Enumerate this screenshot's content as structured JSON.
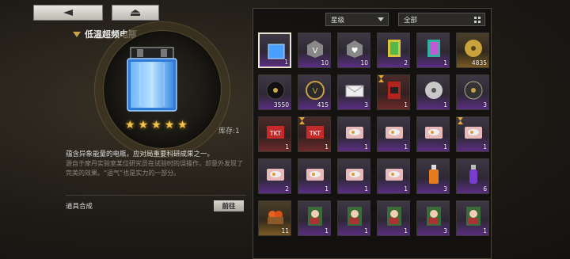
{
  "nav": {
    "back_icon": "back-arrow-icon",
    "home_icon": "home-icon"
  },
  "item": {
    "name": "低温超频电瓶",
    "stars": 5,
    "stock_label": "库存:1",
    "description": "蕴含异象能量的电瓶，应对局重要科研成果之一。",
    "flavor": "源自于摩丹实验室某位研究员在试验时的误操作，却意外发现了完美的效果。“运气”也是实力的一部分。",
    "synth_label": "道具合成",
    "goto_label": "前往"
  },
  "filters": {
    "star_label": "星级",
    "category_label": "全部"
  },
  "inventory": [
    {
      "icon": "battery-icon",
      "count": "1",
      "rarity": "purple",
      "selected": true
    },
    {
      "icon": "badge-icon",
      "count": "10",
      "rarity": "purple"
    },
    {
      "icon": "heart-badge-icon",
      "count": "10",
      "rarity": "purple"
    },
    {
      "icon": "card-pack-gold-icon",
      "count": "2",
      "rarity": "purple"
    },
    {
      "icon": "card-pack-silver-icon",
      "count": "1",
      "rarity": "purple"
    },
    {
      "icon": "gold-record-icon",
      "count": "4835",
      "rarity": "gold"
    },
    {
      "icon": "vinyl-record-icon",
      "count": "3550",
      "rarity": "purple"
    },
    {
      "icon": "gold-emblem-icon",
      "count": "415",
      "rarity": "purple"
    },
    {
      "icon": "envelope-icon",
      "count": "3",
      "rarity": "purple"
    },
    {
      "icon": "red-card-icon",
      "count": "1",
      "rarity": "red",
      "timer": true
    },
    {
      "icon": "silver-disc-icon",
      "count": "1",
      "rarity": "purple"
    },
    {
      "icon": "dark-disc-icon",
      "count": "3",
      "rarity": "purple"
    },
    {
      "icon": "red-ticket-icon",
      "count": "1",
      "rarity": "red"
    },
    {
      "icon": "red-ticket-icon",
      "count": "1",
      "rarity": "red",
      "timer": true
    },
    {
      "icon": "food-box-icon",
      "count": "1",
      "rarity": "purple"
    },
    {
      "icon": "food-box-icon",
      "count": "1",
      "rarity": "purple"
    },
    {
      "icon": "food-box-icon",
      "count": "1",
      "rarity": "purple"
    },
    {
      "icon": "food-box-icon",
      "count": "1",
      "rarity": "purple",
      "timer": true
    },
    {
      "icon": "food-box-icon",
      "count": "2",
      "rarity": "purple"
    },
    {
      "icon": "food-box-icon",
      "count": "1",
      "rarity": "purple"
    },
    {
      "icon": "food-box-icon",
      "count": "1",
      "rarity": "purple"
    },
    {
      "icon": "food-box-icon",
      "count": "1",
      "rarity": "purple"
    },
    {
      "icon": "orange-drink-icon",
      "count": "3",
      "rarity": "purple"
    },
    {
      "icon": "purple-potion-icon",
      "count": "6",
      "rarity": "purple"
    },
    {
      "icon": "fruit-basket-icon",
      "count": "11",
      "rarity": "gold"
    },
    {
      "icon": "character-card-icon",
      "count": "1",
      "rarity": "purple"
    },
    {
      "icon": "character-card-icon",
      "count": "1",
      "rarity": "purple"
    },
    {
      "icon": "character-card-icon",
      "count": "1",
      "rarity": "purple"
    },
    {
      "icon": "character-card-icon",
      "count": "3",
      "rarity": "purple"
    },
    {
      "icon": "character-card-icon",
      "count": "1",
      "rarity": "purple"
    }
  ]
}
